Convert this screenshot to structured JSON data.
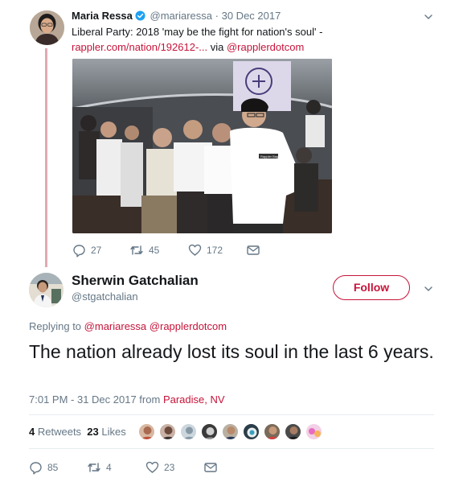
{
  "parent_tweet": {
    "author_name": "Maria Ressa",
    "handle": "@mariaressa",
    "separator": "·",
    "date": "30 Dec 2017",
    "text_line1": "Liberal Party: 2018 'may be the fight for nation's soul' -",
    "link": "rappler.com/nation/192612-...",
    "via_label": "via",
    "via_handle": "@rapplerdotcom",
    "sign_text": "Rappler Bags",
    "actions": {
      "replies": "27",
      "retweets": "45",
      "likes": "172"
    }
  },
  "reply_tweet": {
    "author_name": "Sherwin Gatchalian",
    "handle": "@stgatchalian",
    "follow_label": "Follow",
    "replying_label": "Replying to",
    "replying_to": [
      "@mariaressa",
      "@rapplerdotcom"
    ],
    "text": "The nation already lost its soul in the last 6 years.",
    "time_date": "7:01 PM - 31 Dec 2017 from",
    "location": "Paradise, NV",
    "stats": {
      "retweets_count": "4",
      "retweets_label": "Retweets",
      "likes_count": "23",
      "likes_label": "Likes"
    },
    "actions": {
      "replies": "85",
      "retweets": "4",
      "likes": "23"
    }
  },
  "colors": {
    "accent": "#c6143a",
    "muted": "#657786",
    "text": "#14171a",
    "thread_line": "#e0aab2",
    "verified": "#1da1f2"
  }
}
